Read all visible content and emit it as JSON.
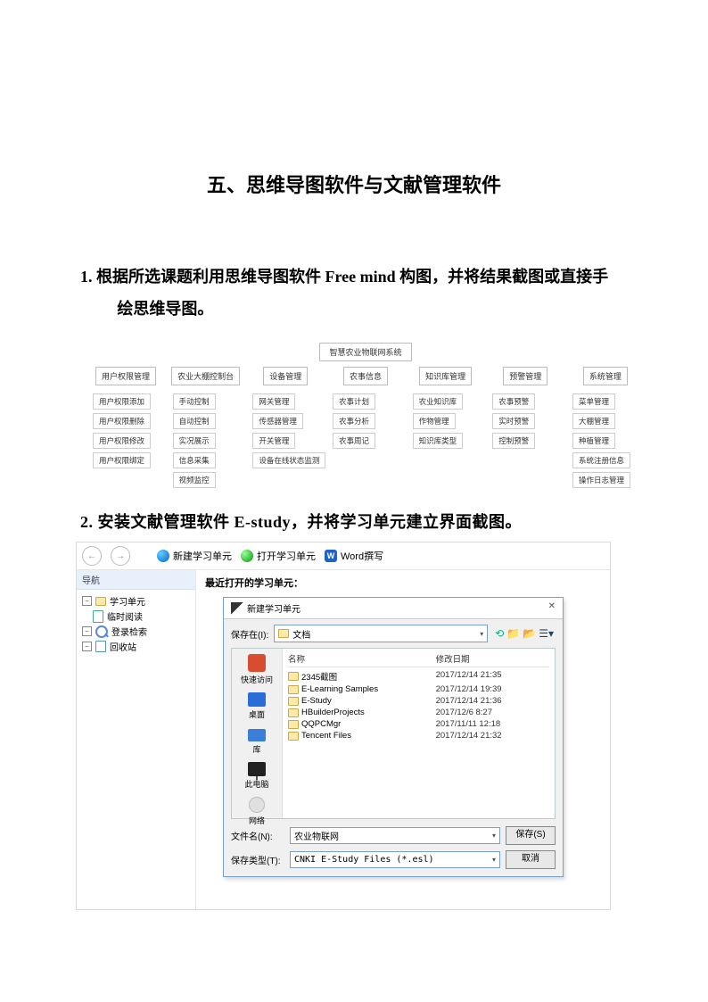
{
  "title": "五、思维导图软件与文献管理软件",
  "heading1": "1. 根据所选课题利用思维导图软件 Free mind 构图，并将结果截图或直接手绘思维导图。",
  "heading2": "2.  安装文献管理软件 E-study，并将学习单元建立界面截图。",
  "chart_data": {
    "type": "org-chart",
    "root": "智慧农业物联网系统",
    "branches": [
      {
        "head": "用户权限管理",
        "children": [
          "用户权限添加",
          "用户权限删除",
          "用户权限修改",
          "用户权限绑定"
        ]
      },
      {
        "head": "农业大棚控制台",
        "children": [
          "手动控制",
          "自动控制",
          "实况展示",
          "信息采集",
          "视频监控"
        ]
      },
      {
        "head": "设备管理",
        "children": [
          "网关管理",
          "传感器管理",
          "开关管理",
          "设备在线状态监测"
        ]
      },
      {
        "head": "农事信息",
        "children": [
          "农事计划",
          "农事分析",
          "农事周记"
        ]
      },
      {
        "head": "知识库管理",
        "children": [
          "农业知识库",
          "作物管理",
          "知识库类型"
        ]
      },
      {
        "head": "预警管理",
        "children": [
          "农事预警",
          "实时预警",
          "控制预警"
        ]
      },
      {
        "head": "系统管理",
        "children": [
          "菜单管理",
          "大棚管理",
          "种植管理",
          "系统注册信息",
          "操作日志管理"
        ]
      }
    ]
  },
  "estudy": {
    "toolbar": {
      "new_unit": "新建学习单元",
      "open_unit": "打开学习单元",
      "word": "Word撰写"
    },
    "sidebar": {
      "header": "导航",
      "items": [
        "学习单元",
        "临时阅读",
        "登录检索",
        "回收站"
      ]
    },
    "main_title": "最近打开的学习单元：",
    "dialog": {
      "title": "新建学习单元",
      "save_in_label": "保存在(I):",
      "location": "文档",
      "col_name": "名称",
      "col_date": "修改日期",
      "places": [
        "快速访问",
        "桌面",
        "库",
        "此电脑",
        "网络"
      ],
      "files": [
        {
          "name": "2345截图",
          "date": "2017/12/14 21:35"
        },
        {
          "name": "E-Learning Samples",
          "date": "2017/12/14 19:39"
        },
        {
          "name": "E-Study",
          "date": "2017/12/14 21:36"
        },
        {
          "name": "HBuilderProjects",
          "date": "2017/12/6 8:27"
        },
        {
          "name": "QQPCMgr",
          "date": "2017/11/11 12:18"
        },
        {
          "name": "Tencent Files",
          "date": "2017/12/14 21:32"
        }
      ],
      "filename_label": "文件名(N):",
      "filename_value": "农业物联网",
      "filetype_label": "保存类型(T):",
      "filetype_value": "CNKI E-Study Files (*.esl)",
      "save_btn": "保存(S)",
      "cancel_btn": "取消"
    }
  }
}
